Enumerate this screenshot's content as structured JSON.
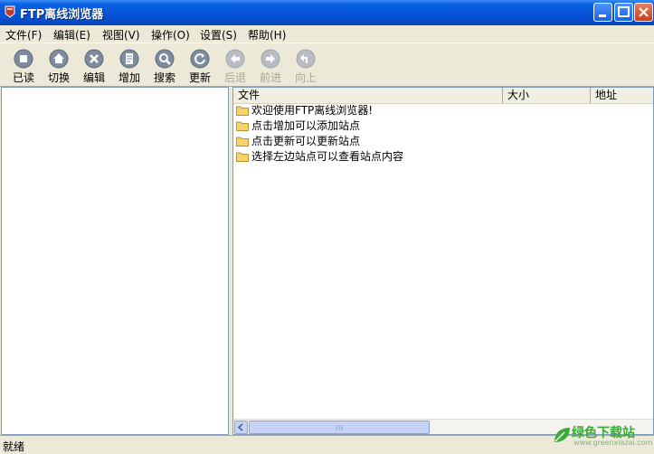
{
  "window": {
    "title": "FTP离线浏览器"
  },
  "menu": [
    {
      "label": "文件(F)"
    },
    {
      "label": "编辑(E)"
    },
    {
      "label": "视图(V)"
    },
    {
      "label": "操作(O)"
    },
    {
      "label": "设置(S)"
    },
    {
      "label": "帮助(H)"
    }
  ],
  "toolbar": [
    {
      "label": "已读",
      "icon": "stop-icon",
      "enabled": true
    },
    {
      "label": "切换",
      "icon": "home-icon",
      "enabled": true
    },
    {
      "label": "编辑",
      "icon": "close-icon",
      "enabled": true
    },
    {
      "label": "增加",
      "icon": "page-icon",
      "enabled": true
    },
    {
      "label": "搜索",
      "icon": "search-icon",
      "enabled": true
    },
    {
      "label": "更新",
      "icon": "refresh-icon",
      "enabled": true
    },
    {
      "label": "后退",
      "icon": "back-icon",
      "enabled": false
    },
    {
      "label": "前进",
      "icon": "forward-icon",
      "enabled": false
    },
    {
      "label": "向上",
      "icon": "up-icon",
      "enabled": false
    }
  ],
  "file_list": {
    "columns": [
      "文件",
      "大小",
      "地址"
    ],
    "rows": [
      {
        "name": "欢迎使用FTP离线浏览器!",
        "icon": "folder-icon"
      },
      {
        "name": "点击增加可以添加站点",
        "icon": "folder-icon"
      },
      {
        "name": "点击更新可以更新站点",
        "icon": "folder-icon"
      },
      {
        "name": "选择左边站点可以查看站点内容",
        "icon": "folder-icon"
      }
    ]
  },
  "status": {
    "text": "就绪"
  },
  "watermark": {
    "main": "绿色下载站",
    "sub": "www.greenxiazai.com"
  },
  "colors": {
    "titlebar": "#0553d8",
    "toolbar_icon": "#7d8c9e",
    "folder": "#f6d46b",
    "watermark": "#3aa935"
  }
}
